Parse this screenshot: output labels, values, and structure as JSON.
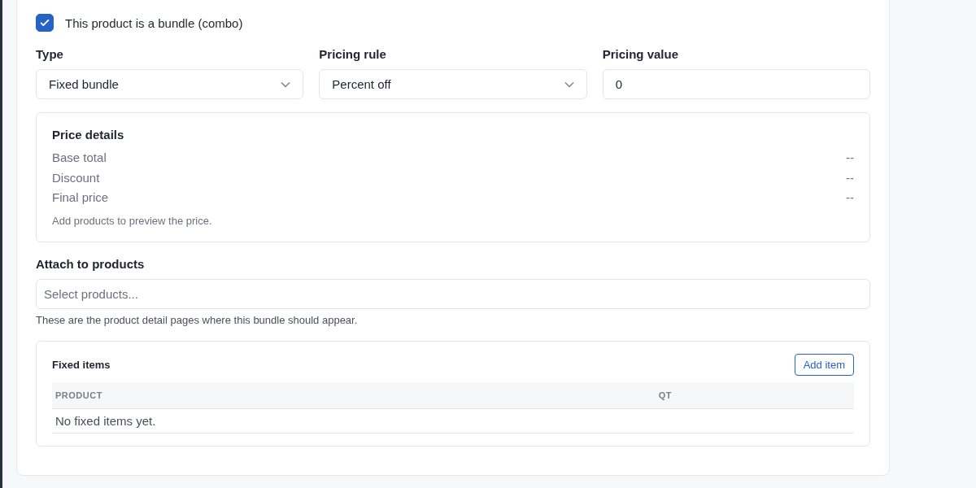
{
  "bundle_checkbox": {
    "label": "This product is a bundle (combo)",
    "checked": true
  },
  "fields": [
    {
      "kind": "select",
      "label": "Type",
      "value": "Fixed bundle"
    },
    {
      "kind": "select",
      "label": "Pricing rule",
      "value": "Percent off"
    },
    {
      "kind": "input",
      "label": "Pricing value",
      "value": "0"
    }
  ],
  "price_details": {
    "title": "Price details",
    "rows": [
      {
        "label": "Base total",
        "value": "--"
      },
      {
        "label": "Discount",
        "value": "--"
      },
      {
        "label": "Final price",
        "value": "--"
      }
    ],
    "note": "Add products to preview the price."
  },
  "attach": {
    "label": "Attach to products",
    "placeholder": "Select products...",
    "help": "These are the product detail pages where this bundle should appear."
  },
  "fixed_items": {
    "title": "Fixed items",
    "button": "Add item",
    "columns": [
      "PRODUCT",
      "QT"
    ],
    "empty": "No fixed items yet."
  }
}
